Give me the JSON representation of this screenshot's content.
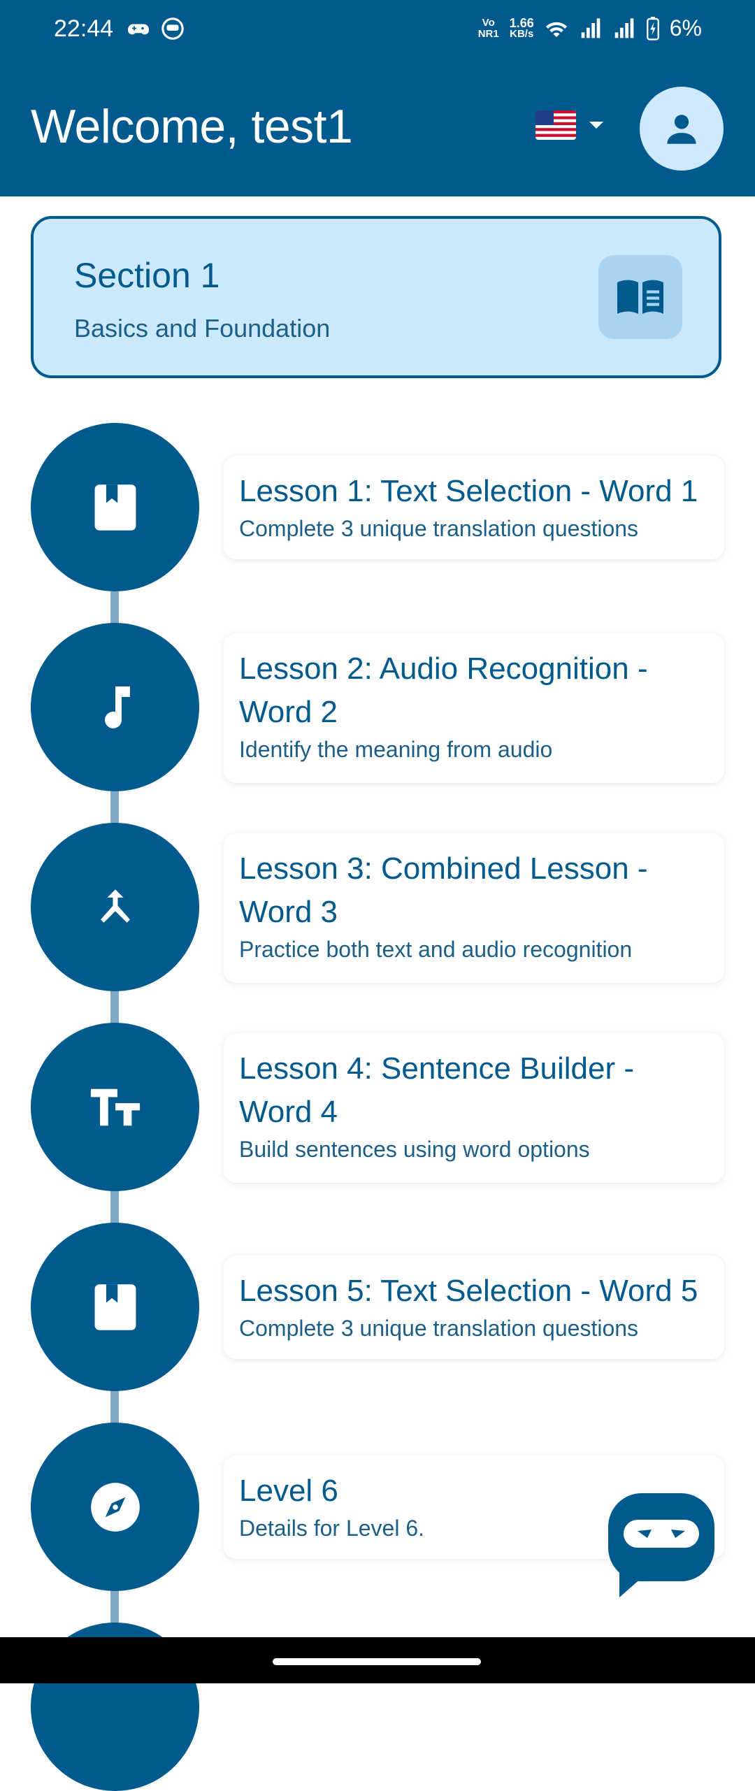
{
  "status_bar": {
    "time": "22:44",
    "network_tag": "Vo NR1",
    "speed_value": "1.66",
    "speed_unit": "KB/s",
    "battery": "6%"
  },
  "header": {
    "welcome_text": "Welcome, test1",
    "language_flag": "us-flag",
    "profile_icon": "person-icon"
  },
  "section": {
    "title": "Section 1",
    "subtitle": "Basics and Foundation",
    "icon": "open-book-icon"
  },
  "lessons": [
    {
      "title": "Lesson 1: Text Selection - Word 1",
      "subtitle": "Complete 3 unique translation questions",
      "icon": "book-icon"
    },
    {
      "title": "Lesson 2: Audio Recognition - Word 2",
      "subtitle": "Identify the meaning from audio",
      "icon": "music-note-icon"
    },
    {
      "title": "Lesson 3: Combined Lesson - Word 3",
      "subtitle": "Practice both text and audio recognition",
      "icon": "merge-icon"
    },
    {
      "title": "Lesson 4: Sentence Builder - Word 4",
      "subtitle": "Build sentences using word options",
      "icon": "text-fields-icon"
    },
    {
      "title": "Lesson 5: Text Selection - Word 5",
      "subtitle": "Complete 3 unique translation questions",
      "icon": "book-icon"
    },
    {
      "title": "Level 6",
      "subtitle": "Details for Level 6.",
      "icon": "compass-icon"
    }
  ],
  "colors": {
    "primary": "#005a8d",
    "section_bg": "#cce8fb",
    "connector": "#7fa9c6"
  }
}
